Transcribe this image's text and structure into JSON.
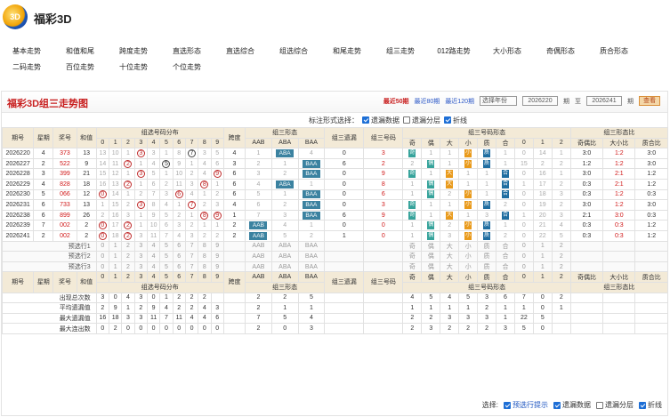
{
  "app": {
    "title": "福彩3D",
    "logo": "3D"
  },
  "nav": [
    [
      "基本走势",
      "和值和尾",
      "跨度走势",
      "直选形态",
      "直选综合",
      "组选综合",
      "和尾走势",
      "组三走势",
      "012路走势",
      "大小形态",
      "奇偶形态",
      "质合形态"
    ],
    [
      "二码走势",
      "百位走势",
      "十位走势",
      "个位走势"
    ]
  ],
  "panel": {
    "title": "福彩3D组三走势图",
    "links": [
      "最近50期",
      "最近80期",
      "最近120期"
    ],
    "select": "选择年份",
    "from": "2026220",
    "to": "2026241",
    "period": "期",
    "to_label": "至",
    "query": "查看"
  },
  "opts": {
    "label": "标注形式选择：",
    "items": [
      [
        "遗漏数据",
        true
      ],
      [
        "遗漏分层",
        false
      ],
      [
        "折线",
        true
      ]
    ]
  },
  "head1": [
    "期号",
    "星期",
    "奖号",
    "和值",
    "组选号码分布",
    "跨度",
    "组三形态",
    "组三遗漏",
    "组三号码",
    "组三号码形态",
    "组三形态比"
  ],
  "head2": {
    "digits": [
      "0",
      "1",
      "2",
      "3",
      "4",
      "5",
      "6",
      "7",
      "8",
      "9"
    ],
    "forms": [
      "AAB",
      "ABA",
      "BAA"
    ],
    "shapes": [
      "奇",
      "偶",
      "大",
      "小",
      "质",
      "合",
      "0",
      "1",
      "2"
    ],
    "ratios": [
      "奇偶比",
      "大小比",
      "质合比"
    ]
  },
  "rows": [
    {
      "qh": "2026220",
      "wk": "4",
      "num": "373",
      "sum": "13",
      "dist": [
        "13",
        "10",
        "1",
        "③",
        "3",
        "1",
        "8",
        "⑦",
        "3",
        "5"
      ],
      "span": "4",
      "form": [
        "1",
        "ABA",
        "4"
      ],
      "miss": "0",
      "hm": "3",
      "shp": [
        "奇",
        "1",
        "1",
        "小",
        "质",
        "1",
        "0",
        "14",
        "1"
      ],
      "r": [
        "3:0",
        "1:2",
        "3:0"
      ]
    },
    {
      "qh": "2026227",
      "wk": "2",
      "num": "522",
      "sum": "9",
      "dist": [
        "14",
        "11",
        "②",
        "1",
        "4",
        "⑤",
        "9",
        "1",
        "4",
        "6"
      ],
      "span": "3",
      "form": [
        "2",
        "1",
        "BAA"
      ],
      "miss": "6",
      "hm": "2",
      "shp": [
        "2",
        "偶",
        "1",
        "小",
        "质",
        "1",
        "15",
        "2",
        "2"
      ],
      "r": [
        "1:2",
        "1:2",
        "3:0"
      ]
    },
    {
      "qh": "2026228",
      "wk": "3",
      "num": "399",
      "sum": "21",
      "dist": [
        "15",
        "12",
        "1",
        "③",
        "5",
        "1",
        "10",
        "2",
        "4",
        "⑨"
      ],
      "span": "6",
      "form": [
        "3",
        "2",
        "BAA"
      ],
      "miss": "0",
      "hm": "9",
      "shp": [
        "奇",
        "1",
        "大",
        "1",
        "1",
        "合",
        "0",
        "16",
        "1"
      ],
      "r": [
        "3:0",
        "2:1",
        "1:2"
      ]
    },
    {
      "qh": "2026229",
      "wk": "4",
      "num": "828",
      "sum": "18",
      "dist": [
        "16",
        "13",
        "②",
        "1",
        "6",
        "2",
        "11",
        "3",
        "⑧",
        "1"
      ],
      "span": "6",
      "form": [
        "4",
        "ABA",
        "1"
      ],
      "miss": "0",
      "hm": "8",
      "shp": [
        "1",
        "偶",
        "大",
        "1",
        "1",
        "合",
        "1",
        "17",
        "2"
      ],
      "r": [
        "0:3",
        "2:1",
        "1:2"
      ]
    },
    {
      "qh": "2026230",
      "wk": "5",
      "num": "066",
      "sum": "12",
      "dist": [
        "⓪",
        "14",
        "1",
        "2",
        "7",
        "3",
        "⑥",
        "4",
        "1",
        "2"
      ],
      "span": "6",
      "form": [
        "5",
        "1",
        "BAA"
      ],
      "miss": "0",
      "hm": "6",
      "shp": [
        "1",
        "偶",
        "2",
        "小",
        "1",
        "合",
        "0",
        "18",
        "3"
      ],
      "r": [
        "0:3",
        "1:2",
        "0:3"
      ]
    },
    {
      "qh": "2026231",
      "wk": "6",
      "num": "733",
      "sum": "13",
      "dist": [
        "1",
        "15",
        "2",
        "③",
        "8",
        "4",
        "1",
        "⑦",
        "2",
        "3"
      ],
      "span": "4",
      "form": [
        "6",
        "2",
        "BAA"
      ],
      "miss": "0",
      "hm": "3",
      "shp": [
        "奇",
        "1",
        "1",
        "小",
        "质",
        "2",
        "0",
        "19",
        "2"
      ],
      "r": [
        "3:0",
        "1:2",
        "3:0"
      ]
    },
    {
      "qh": "2026238",
      "wk": "6",
      "num": "899",
      "sum": "26",
      "dist": [
        "2",
        "16",
        "3",
        "1",
        "9",
        "5",
        "2",
        "1",
        "⑧",
        "⑨"
      ],
      "span": "1",
      "form": [
        "7",
        "3",
        "BAA"
      ],
      "miss": "6",
      "hm": "9",
      "shp": [
        "奇",
        "1",
        "大",
        "1",
        "3",
        "合",
        "1",
        "20",
        "3"
      ],
      "r": [
        "2:1",
        "3:0",
        "0:3"
      ]
    },
    {
      "qh": "2026239",
      "wk": "7",
      "num": "002",
      "sum": "2",
      "dist": [
        "⓪",
        "17",
        "②",
        "1",
        "10",
        "6",
        "3",
        "2",
        "1",
        "1"
      ],
      "span": "2",
      "form": [
        "AAB",
        "4",
        "1"
      ],
      "miss": "0",
      "hm": "0",
      "shp": [
        "1",
        "偶",
        "2",
        "小",
        "质",
        "1",
        "0",
        "21",
        "4"
      ],
      "r": [
        "0:3",
        "0:3",
        "1:2"
      ]
    },
    {
      "qh": "2026241",
      "wk": "2",
      "num": "002",
      "sum": "2",
      "dist": [
        "⓪",
        "18",
        "②",
        "3",
        "11",
        "7",
        "4",
        "3",
        "2",
        "2"
      ],
      "span": "2",
      "form": [
        "AAB",
        "5",
        "2"
      ],
      "miss": "1",
      "hm": "0",
      "shp": [
        "1",
        "偶",
        "3",
        "小",
        "质",
        "2",
        "0",
        "22",
        "5"
      ],
      "r": [
        "0:3",
        "0:3",
        "1:2"
      ]
    }
  ],
  "fore": [
    {
      "label": "预选行1"
    },
    {
      "label": "预选行2"
    },
    {
      "label": "预选行3"
    }
  ],
  "stats": [
    {
      "label": "出现总次数",
      "dist": [
        "3",
        "0",
        "4",
        "3",
        "0",
        "1",
        "2",
        "2",
        "2"
      ],
      "f": [
        "2",
        "2",
        "5"
      ],
      "m": [],
      "s": [
        "4",
        "5",
        "4",
        "5",
        "3",
        "6",
        "7",
        "0",
        "2"
      ]
    },
    {
      "label": "平均遗漏值",
      "dist": [
        "2",
        "9",
        "1",
        "2",
        "9",
        "4",
        "2",
        "2",
        "4",
        "3"
      ],
      "f": [
        "2",
        "1",
        "1"
      ],
      "m": [],
      "s": [
        "1",
        "1",
        "1",
        "1",
        "2",
        "1",
        "1",
        "0",
        "1"
      ]
    },
    {
      "label": "最大遗漏值",
      "dist": [
        "16",
        "18",
        "3",
        "3",
        "11",
        "7",
        "11",
        "4",
        "4",
        "6"
      ],
      "f": [
        "7",
        "5",
        "4"
      ],
      "m": [],
      "s": [
        "2",
        "2",
        "3",
        "3",
        "3",
        "1",
        "22",
        "5",
        ""
      ]
    },
    {
      "label": "最大连出数",
      "dist": [
        "0",
        "2",
        "0",
        "0",
        "0",
        "0",
        "0",
        "0",
        "0",
        "0"
      ],
      "f": [
        "2",
        "0",
        "3"
      ],
      "m": [],
      "s": [
        "2",
        "3",
        "2",
        "2",
        "2",
        "3",
        "5",
        "0",
        ""
      ]
    }
  ],
  "bottom": {
    "label": "选择:",
    "items": [
      [
        "预选行提示",
        true
      ],
      [
        "遗漏数据",
        true
      ],
      [
        "遗漏分层",
        false
      ],
      [
        "折线",
        true
      ]
    ]
  }
}
